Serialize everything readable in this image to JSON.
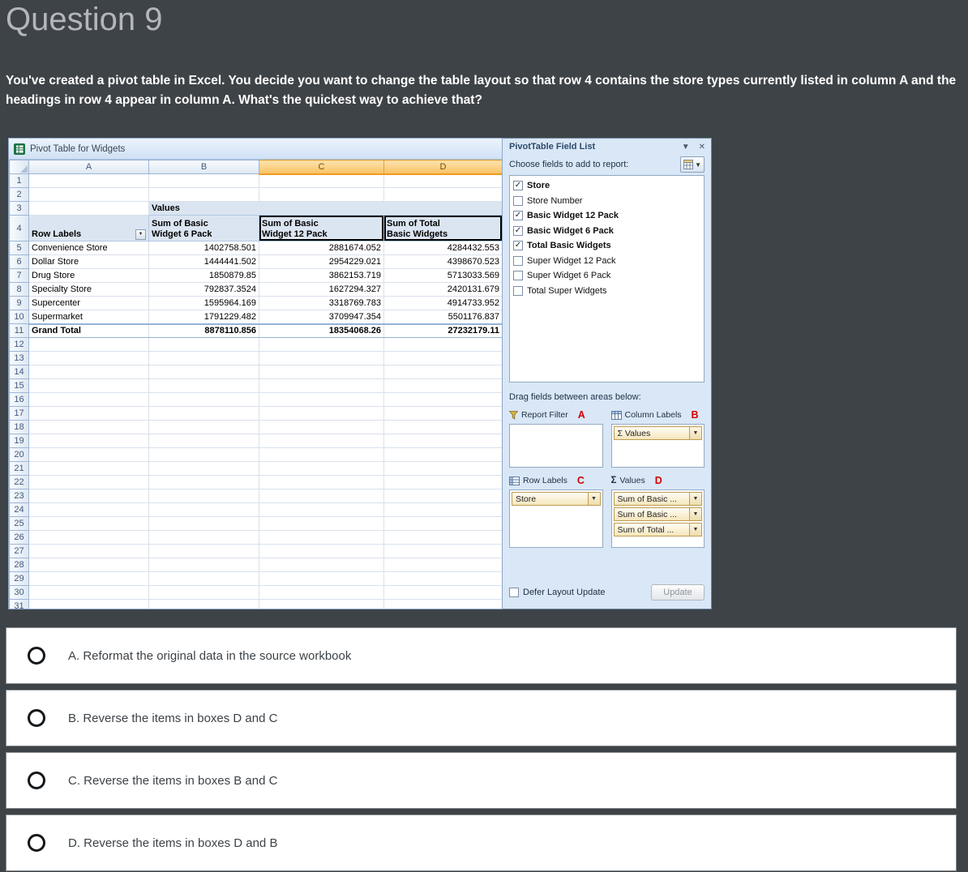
{
  "page": {
    "title": "Question 9",
    "question": "You've created a pivot table in Excel. You decide you want to change the table layout so that row 4 contains the store types currently listed in column A and the headings in row 4 appear in column A. What's the quickest way to achieve that?"
  },
  "excel": {
    "window_title": "Pivot Table for Widgets",
    "col_headers": [
      "A",
      "B",
      "C",
      "D"
    ],
    "selected_columns": [
      "C",
      "D"
    ],
    "values_label": "Values",
    "header_row": {
      "row_labels": "Row Labels",
      "col_b": "Sum of Basic\nWidget 6 Pack",
      "col_c": "Sum of Basic\nWidget 12 Pack",
      "col_d": "Sum of Total\nBasic Widgets"
    },
    "data_rows": [
      [
        "Convenience Store",
        "1402758.501",
        "2881674.052",
        "4284432.553"
      ],
      [
        "Dollar Store",
        "1444441.502",
        "2954229.021",
        "4398670.523"
      ],
      [
        "Drug Store",
        "1850879.85",
        "3862153.719",
        "5713033.569"
      ],
      [
        "Specialty Store",
        "792837.3524",
        "1627294.327",
        "2420131.679"
      ],
      [
        "Supercenter",
        "1595964.169",
        "3318769.783",
        "4914733.952"
      ],
      [
        "Supermarket",
        "1791229.482",
        "3709947.354",
        "5501176.837"
      ]
    ],
    "grand_total_row": [
      "Grand Total",
      "8878110.856",
      "18354068.26",
      "27232179.11"
    ],
    "last_row_number": 31
  },
  "field_list": {
    "title": "PivotTable Field List",
    "collapse_icon": "chevron-down",
    "close_icon": "close",
    "choose_label": "Choose fields to add to report:",
    "fields": [
      {
        "name": "Store",
        "checked": true
      },
      {
        "name": "Store Number",
        "checked": false
      },
      {
        "name": "Basic Widget 12 Pack",
        "checked": true
      },
      {
        "name": "Basic Widget 6 Pack",
        "checked": true
      },
      {
        "name": "Total Basic Widgets",
        "checked": true
      },
      {
        "name": "Super Widget 12 Pack",
        "checked": false
      },
      {
        "name": "Super Widget 6 Pack",
        "checked": false
      },
      {
        "name": "Total Super Widgets",
        "checked": false
      }
    ],
    "drag_label": "Drag fields between areas below:",
    "areas": [
      {
        "id": "report-filter",
        "label": "Report Filter",
        "icon": "funnel",
        "tag": "A",
        "items": []
      },
      {
        "id": "column-labels",
        "label": "Column Labels",
        "icon": "table-cols",
        "tag": "B",
        "items": [
          "Σ Values"
        ]
      },
      {
        "id": "row-labels",
        "label": "Row Labels",
        "icon": "table-rows",
        "tag": "C",
        "items": [
          "Store"
        ]
      },
      {
        "id": "values",
        "label": "Values",
        "icon": "sigma",
        "tag": "D",
        "items": [
          "Sum of Basic ...",
          "Sum of Basic ...",
          "Sum of Total ..."
        ]
      }
    ],
    "defer_label": "Defer Layout Update",
    "update_label": "Update"
  },
  "options": [
    {
      "letter": "A",
      "text": "A. Reformat the original data in the source workbook"
    },
    {
      "letter": "B",
      "text": "B. Reverse the items in boxes D and C"
    },
    {
      "letter": "C",
      "text": "C. Reverse the items in boxes B and C"
    },
    {
      "letter": "D",
      "text": "D. Reverse the items in boxes D and B"
    }
  ]
}
